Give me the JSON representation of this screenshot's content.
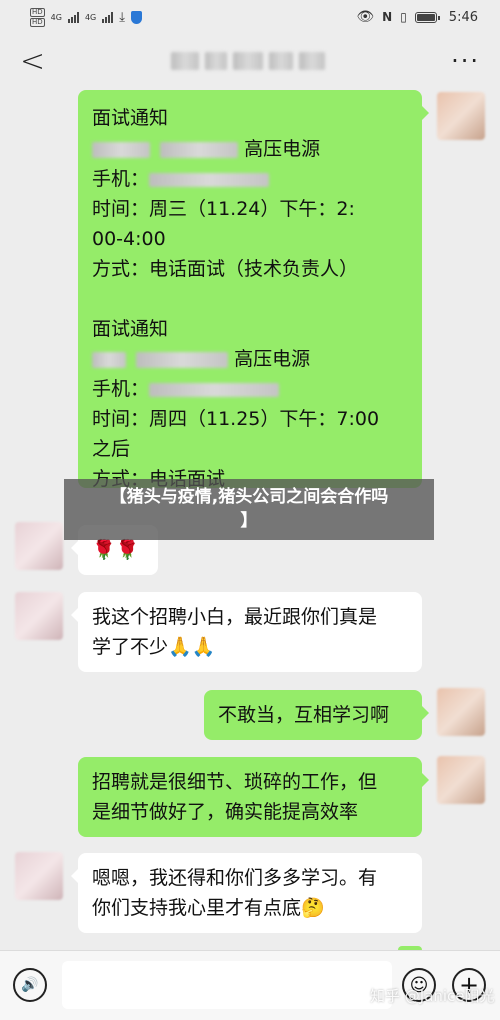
{
  "status": {
    "left_badges": [
      "HD",
      "HD"
    ],
    "net": [
      "4G",
      "4G"
    ],
    "time": "5:46"
  },
  "header": {
    "back": "<",
    "more": "···"
  },
  "messages": {
    "m1": {
      "title": "面试通知",
      "line2_suffix": "高压电源",
      "line3": "手机：",
      "line4": "时间：周三（11.24）下午：2:",
      "line5": "00-4:00",
      "line6": "方式：电话面试（技术负责人）",
      "title2": "面试通知",
      "line8_suffix": "高压电源",
      "line9": "手机：",
      "line10": "时间：周四（11.25）下午：7:00",
      "line11": "之后",
      "line12": "方式：电话面试"
    },
    "m2": {
      "text": "🌹🌹"
    },
    "m3": {
      "line1": "我这个招聘小白，最近跟你们真是",
      "line2": "学了不少🙏🙏"
    },
    "m4": {
      "text": "不敢当，互相学习啊"
    },
    "m5": {
      "line1": "招聘就是很细节、琐碎的工作，但",
      "line2": "是细节做好了，确实能提高效率"
    },
    "m6": {
      "line1": "嗯嗯，我还得和你们多多学习。有",
      "line2": "你们支持我心里才有点底🤔"
    }
  },
  "banner": {
    "line1": "【猪头与疫情,猪头公司之间会合作吗",
    "line2": "】"
  },
  "footer": {
    "voice": "🔊",
    "emoji": "☺",
    "plus": "+",
    "watermark": "知乎 @Janice阳光"
  }
}
